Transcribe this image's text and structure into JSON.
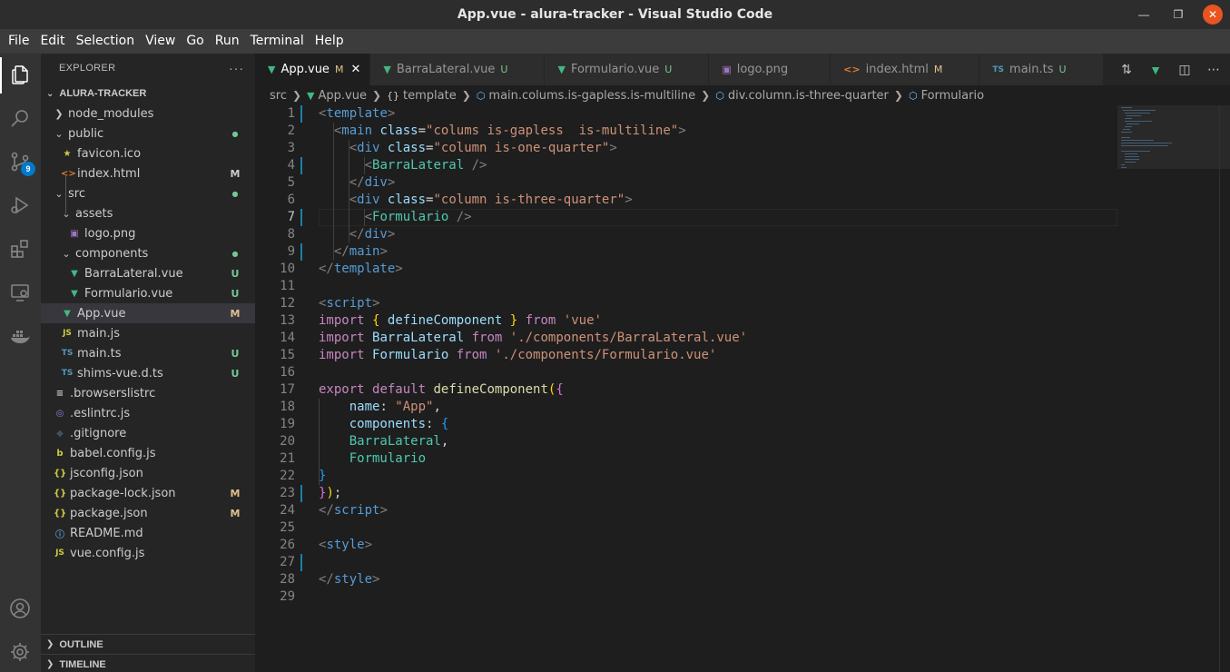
{
  "window": {
    "title": "App.vue - alura-tracker - Visual Studio Code"
  },
  "menu": [
    "File",
    "Edit",
    "Selection",
    "View",
    "Go",
    "Run",
    "Terminal",
    "Help"
  ],
  "activity": {
    "scm_badge": "9"
  },
  "explorer": {
    "header": "EXPLORER",
    "more": "···",
    "root": "ALURA-TRACKER",
    "items": [
      {
        "name": "node_modules",
        "type": "folder",
        "depth": 1,
        "open": false,
        "status": "",
        "status_color": ""
      },
      {
        "name": "public",
        "type": "folder",
        "depth": 1,
        "open": true,
        "status": "●",
        "status_color": "#73c991"
      },
      {
        "name": "favicon.ico",
        "type": "star",
        "depth": 2,
        "status": "",
        "status_color": ""
      },
      {
        "name": "index.html",
        "type": "html",
        "depth": 2,
        "status": "M",
        "status_color": "#cccccc"
      },
      {
        "name": "src",
        "type": "folder",
        "depth": 1,
        "open": true,
        "status": "●",
        "status_color": "#73c991"
      },
      {
        "name": "assets",
        "type": "folder",
        "depth": 2,
        "open": true,
        "status": "",
        "status_color": ""
      },
      {
        "name": "logo.png",
        "type": "png",
        "depth": 3,
        "status": "",
        "status_color": ""
      },
      {
        "name": "components",
        "type": "folder",
        "depth": 2,
        "open": true,
        "status": "●",
        "status_color": "#73c991"
      },
      {
        "name": "BarraLateral.vue",
        "type": "vue",
        "depth": 3,
        "status": "U",
        "status_color": "#73c991"
      },
      {
        "name": "Formulario.vue",
        "type": "vue",
        "depth": 3,
        "status": "U",
        "status_color": "#73c991"
      },
      {
        "name": "App.vue",
        "type": "vue",
        "depth": 2,
        "status": "M",
        "status_color": "#e2c08d",
        "selected": true
      },
      {
        "name": "main.js",
        "type": "js",
        "depth": 2,
        "status": "",
        "status_color": ""
      },
      {
        "name": "main.ts",
        "type": "ts",
        "depth": 2,
        "status": "U",
        "status_color": "#73c991"
      },
      {
        "name": "shims-vue.d.ts",
        "type": "ts",
        "depth": 2,
        "status": "U",
        "status_color": "#73c991"
      },
      {
        "name": ".browserslistrc",
        "type": "lines",
        "depth": 1,
        "status": "",
        "status_color": ""
      },
      {
        "name": ".eslintrc.js",
        "type": "eslint",
        "depth": 1,
        "status": "",
        "status_color": ""
      },
      {
        "name": ".gitignore",
        "type": "git",
        "depth": 1,
        "status": "",
        "status_color": ""
      },
      {
        "name": "babel.config.js",
        "type": "babel",
        "depth": 1,
        "status": "",
        "status_color": ""
      },
      {
        "name": "jsconfig.json",
        "type": "json",
        "depth": 1,
        "status": "",
        "status_color": ""
      },
      {
        "name": "package-lock.json",
        "type": "json",
        "depth": 1,
        "status": "M",
        "status_color": "#e2c08d"
      },
      {
        "name": "package.json",
        "type": "json",
        "depth": 1,
        "status": "M",
        "status_color": "#e2c08d"
      },
      {
        "name": "README.md",
        "type": "info",
        "depth": 1,
        "status": "",
        "status_color": ""
      },
      {
        "name": "vue.config.js",
        "type": "js",
        "depth": 1,
        "status": "",
        "status_color": ""
      }
    ],
    "outline": "OUTLINE",
    "timeline": "TIMELINE"
  },
  "tabs": [
    {
      "label": "App.vue",
      "icon": "vue",
      "status": "M",
      "active": true,
      "close": "✕"
    },
    {
      "label": "BarraLateral.vue",
      "icon": "vue",
      "status": "U",
      "active": false
    },
    {
      "label": "Formulario.vue",
      "icon": "vue",
      "status": "U",
      "active": false
    },
    {
      "label": "logo.png",
      "icon": "png",
      "status": "",
      "active": false
    },
    {
      "label": "index.html",
      "icon": "html",
      "status": "M",
      "active": false
    },
    {
      "label": "main.ts",
      "icon": "ts",
      "status": "U",
      "active": false
    }
  ],
  "breadcrumb": [
    {
      "label": "src",
      "icon": ""
    },
    {
      "label": "App.vue",
      "icon": "vue"
    },
    {
      "label": "template",
      "icon": "braces"
    },
    {
      "label": "main.colums.is-gapless.is-multiline",
      "icon": "elem"
    },
    {
      "label": "div.column.is-three-quarter",
      "icon": "elem"
    },
    {
      "label": "Formulario",
      "icon": "elem"
    }
  ],
  "editor": {
    "current_line": 7,
    "lines": [
      [
        [
          "t-br",
          "<"
        ],
        [
          "t-tag",
          "template"
        ],
        [
          "t-br",
          ">"
        ]
      ],
      [
        [
          "t-plain",
          "  "
        ],
        [
          "t-br",
          "<"
        ],
        [
          "t-tag",
          "main"
        ],
        [
          "t-plain",
          " "
        ],
        [
          "t-attr",
          "class"
        ],
        [
          "t-plain",
          "="
        ],
        [
          "t-str",
          "\"colums is-gapless  is-multiline\""
        ],
        [
          "t-br",
          ">"
        ]
      ],
      [
        [
          "t-plain",
          "    "
        ],
        [
          "t-br",
          "<"
        ],
        [
          "t-tag",
          "div"
        ],
        [
          "t-plain",
          " "
        ],
        [
          "t-attr",
          "class"
        ],
        [
          "t-plain",
          "="
        ],
        [
          "t-str",
          "\"column is-one-quarter\""
        ],
        [
          "t-br",
          ">"
        ]
      ],
      [
        [
          "t-plain",
          "      "
        ],
        [
          "t-br",
          "<"
        ],
        [
          "t-comp",
          "BarraLateral"
        ],
        [
          "t-plain",
          " "
        ],
        [
          "t-br",
          "/>"
        ]
      ],
      [
        [
          "t-plain",
          "    "
        ],
        [
          "t-br",
          "</"
        ],
        [
          "t-tag",
          "div"
        ],
        [
          "t-br",
          ">"
        ]
      ],
      [
        [
          "t-plain",
          "    "
        ],
        [
          "t-br",
          "<"
        ],
        [
          "t-tag",
          "div"
        ],
        [
          "t-plain",
          " "
        ],
        [
          "t-attr",
          "class"
        ],
        [
          "t-plain",
          "="
        ],
        [
          "t-str",
          "\"column is-three-quarter\""
        ],
        [
          "t-br",
          ">"
        ]
      ],
      [
        [
          "t-plain",
          "      "
        ],
        [
          "t-br",
          "<"
        ],
        [
          "t-comp",
          "Formulario"
        ],
        [
          "t-plain",
          " "
        ],
        [
          "t-br",
          "/>"
        ]
      ],
      [
        [
          "t-plain",
          "    "
        ],
        [
          "t-br",
          "</"
        ],
        [
          "t-tag",
          "div"
        ],
        [
          "t-br",
          ">"
        ]
      ],
      [
        [
          "t-plain",
          "  "
        ],
        [
          "t-br",
          "</"
        ],
        [
          "t-tag",
          "main"
        ],
        [
          "t-br",
          ">"
        ]
      ],
      [
        [
          "t-br",
          "</"
        ],
        [
          "t-tag",
          "template"
        ],
        [
          "t-br",
          ">"
        ]
      ],
      [],
      [
        [
          "t-br",
          "<"
        ],
        [
          "t-tag",
          "script"
        ],
        [
          "t-br",
          ">"
        ]
      ],
      [
        [
          "t-kw",
          "import"
        ],
        [
          "t-plain",
          " "
        ],
        [
          "t-b1",
          "{"
        ],
        [
          "t-plain",
          " "
        ],
        [
          "t-var",
          "defineComponent"
        ],
        [
          "t-plain",
          " "
        ],
        [
          "t-b1",
          "}"
        ],
        [
          "t-plain",
          " "
        ],
        [
          "t-kw",
          "from"
        ],
        [
          "t-plain",
          " "
        ],
        [
          "t-str",
          "'vue'"
        ]
      ],
      [
        [
          "t-kw",
          "import"
        ],
        [
          "t-plain",
          " "
        ],
        [
          "t-var",
          "BarraLateral"
        ],
        [
          "t-plain",
          " "
        ],
        [
          "t-kw",
          "from"
        ],
        [
          "t-plain",
          " "
        ],
        [
          "t-str",
          "'./components/BarraLateral.vue'"
        ]
      ],
      [
        [
          "t-kw",
          "import"
        ],
        [
          "t-plain",
          " "
        ],
        [
          "t-var",
          "Formulario"
        ],
        [
          "t-plain",
          " "
        ],
        [
          "t-kw",
          "from"
        ],
        [
          "t-plain",
          " "
        ],
        [
          "t-str",
          "'./components/Formulario.vue'"
        ]
      ],
      [],
      [
        [
          "t-kw",
          "export"
        ],
        [
          "t-plain",
          " "
        ],
        [
          "t-kw",
          "default"
        ],
        [
          "t-plain",
          " "
        ],
        [
          "t-fn",
          "defineComponent"
        ],
        [
          "t-b1",
          "("
        ],
        [
          "t-b2",
          "{"
        ]
      ],
      [
        [
          "t-plain",
          "    "
        ],
        [
          "t-var",
          "name"
        ],
        [
          "t-plain",
          ": "
        ],
        [
          "t-str",
          "\"App\""
        ],
        [
          "t-plain",
          ","
        ]
      ],
      [
        [
          "t-plain",
          "    "
        ],
        [
          "t-var",
          "components"
        ],
        [
          "t-plain",
          ": "
        ],
        [
          "t-b3",
          "{"
        ]
      ],
      [
        [
          "t-plain",
          "    "
        ],
        [
          "t-comp2",
          "BarraLateral"
        ],
        [
          "t-plain",
          ","
        ]
      ],
      [
        [
          "t-plain",
          "    "
        ],
        [
          "t-comp2",
          "Formulario"
        ]
      ],
      [
        [
          "t-b3",
          "}"
        ]
      ],
      [
        [
          "t-b2",
          "}"
        ],
        [
          "t-b1",
          ")"
        ],
        [
          "t-plain",
          ";"
        ]
      ],
      [
        [
          "t-br",
          "</"
        ],
        [
          "t-tag",
          "script"
        ],
        [
          "t-br",
          ">"
        ]
      ],
      [],
      [
        [
          "t-br",
          "<"
        ],
        [
          "t-tag",
          "style"
        ],
        [
          "t-br",
          ">"
        ]
      ],
      [],
      [
        [
          "t-br",
          "</"
        ],
        [
          "t-tag",
          "style"
        ],
        [
          "t-br",
          ">"
        ]
      ],
      []
    ]
  }
}
